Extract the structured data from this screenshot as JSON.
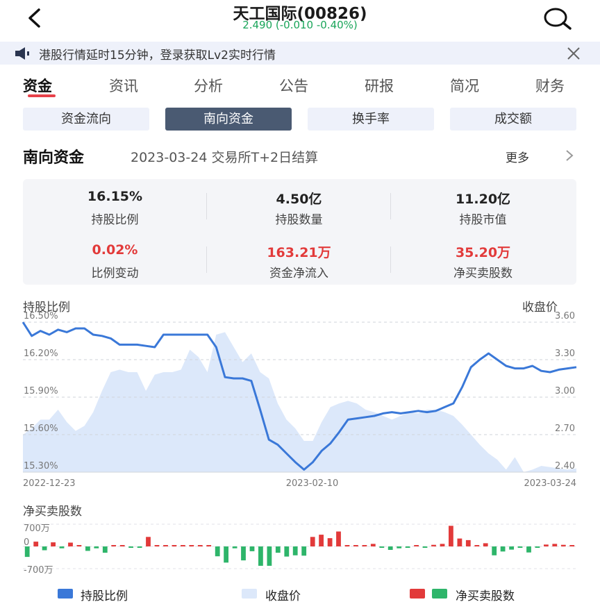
{
  "header": {
    "title": "天工国际(00826)",
    "quote": "2.490 (-0.010 -0.40%)"
  },
  "notice": {
    "text": "港股行情延时15分钟，登录获取Lv2实时行情"
  },
  "tabs": [
    {
      "label": "资金",
      "active": true
    },
    {
      "label": "资讯"
    },
    {
      "label": "分析"
    },
    {
      "label": "公告"
    },
    {
      "label": "研报"
    },
    {
      "label": "简况"
    },
    {
      "label": "财务"
    }
  ],
  "segments": [
    {
      "label": "资金流向"
    },
    {
      "label": "南向资金",
      "active": true
    },
    {
      "label": "换手率"
    },
    {
      "label": "成交额"
    }
  ],
  "section": {
    "title": "南向资金",
    "subtitle": "2023-03-24 交易所T+2日结算",
    "more": "更多"
  },
  "stats": [
    {
      "value": "16.15%",
      "label": "持股比例"
    },
    {
      "value": "4.50亿",
      "label": "持股数量"
    },
    {
      "value": "11.20亿",
      "label": "持股市值"
    },
    {
      "value": "0.02%",
      "label": "比例变动",
      "color": "red"
    },
    {
      "value": "163.21万",
      "label": "资金净流入",
      "color": "red"
    },
    {
      "value": "35.20万",
      "label": "净买卖股数",
      "color": "red"
    }
  ],
  "chart_data": [
    {
      "type": "line",
      "left_axis_title": "持股比例",
      "right_axis_title": "收盘价",
      "y_left_ticks": [
        "16.50%",
        "16.20%",
        "15.90%",
        "15.60%",
        "15.30%"
      ],
      "y_right_ticks": [
        "3.60",
        "3.30",
        "3.00",
        "2.70",
        "2.40"
      ],
      "ylim_left": [
        15.3,
        16.5
      ],
      "ylim_right": [
        2.4,
        3.6
      ],
      "x_ticks": [
        "2022-12-23",
        "2023-02-10",
        "2023-03-24"
      ],
      "series": [
        {
          "name": "持股比例",
          "kind": "line",
          "axis": "left",
          "color": "#3a78d8",
          "values": [
            16.5,
            16.39,
            16.43,
            16.4,
            16.44,
            16.42,
            16.45,
            16.45,
            16.4,
            16.39,
            16.37,
            16.32,
            16.32,
            16.32,
            16.31,
            16.3,
            16.4,
            16.4,
            16.4,
            16.4,
            16.4,
            16.4,
            16.3,
            16.06,
            16.05,
            16.05,
            16.03,
            15.8,
            15.56,
            15.52,
            15.45,
            15.38,
            15.32,
            15.38,
            15.47,
            15.53,
            15.62,
            15.72,
            15.73,
            15.74,
            15.75,
            15.77,
            15.78,
            15.77,
            15.78,
            15.79,
            15.78,
            15.79,
            15.82,
            15.85,
            15.98,
            16.14,
            16.2,
            16.25,
            16.2,
            16.15,
            16.13,
            16.13,
            16.15,
            16.11,
            16.1,
            16.12,
            16.13,
            16.14
          ]
        },
        {
          "name": "收盘价",
          "kind": "area",
          "axis": "right",
          "color": "#dce8fa",
          "values": [
            2.7,
            2.75,
            2.82,
            2.82,
            2.9,
            2.8,
            2.73,
            2.77,
            2.88,
            3.05,
            3.2,
            3.22,
            3.2,
            3.2,
            3.05,
            3.18,
            3.2,
            3.2,
            3.22,
            3.38,
            3.32,
            3.2,
            3.5,
            3.52,
            3.4,
            3.28,
            3.35,
            3.2,
            3.15,
            2.95,
            2.82,
            2.75,
            2.65,
            2.65,
            2.8,
            2.92,
            2.95,
            2.97,
            2.95,
            2.9,
            2.88,
            2.85,
            2.82,
            2.85,
            2.88,
            2.87,
            2.9,
            2.9,
            2.88,
            2.85,
            2.78,
            2.7,
            2.62,
            2.55,
            2.5,
            2.42,
            2.52,
            2.4,
            2.42,
            2.45,
            2.44,
            2.43,
            2.42,
            2.43
          ]
        }
      ]
    },
    {
      "type": "bar",
      "title": "净买卖股数",
      "y_ticks": [
        "700万",
        "0",
        "-700万"
      ],
      "ylim": [
        -700,
        700
      ],
      "unit": "万",
      "colors": {
        "positive": "#e23a3a",
        "negative": "#2eb56a"
      },
      "values": [
        -330,
        150,
        -120,
        130,
        -60,
        120,
        20,
        -140,
        -60,
        -200,
        0,
        20,
        -30,
        -40,
        300,
        0,
        0,
        0,
        0,
        0,
        0,
        0,
        -310,
        -510,
        -60,
        -440,
        -150,
        -610,
        -610,
        -200,
        -320,
        -280,
        -290,
        300,
        370,
        260,
        470,
        40,
        30,
        20,
        80,
        -30,
        -110,
        -60,
        -30,
        20,
        -30,
        50,
        80,
        650,
        250,
        200,
        30,
        100,
        -280,
        -160,
        -100,
        -30,
        -190,
        -30,
        60,
        80,
        50,
        40
      ]
    }
  ],
  "legend": [
    {
      "label": "持股比例",
      "color": "#3a78d8"
    },
    {
      "label": "收盘价",
      "color": "#dce8fa"
    },
    {
      "label": "净买卖股数",
      "colors": [
        "#e23a3a",
        "#2eb56a"
      ]
    }
  ]
}
